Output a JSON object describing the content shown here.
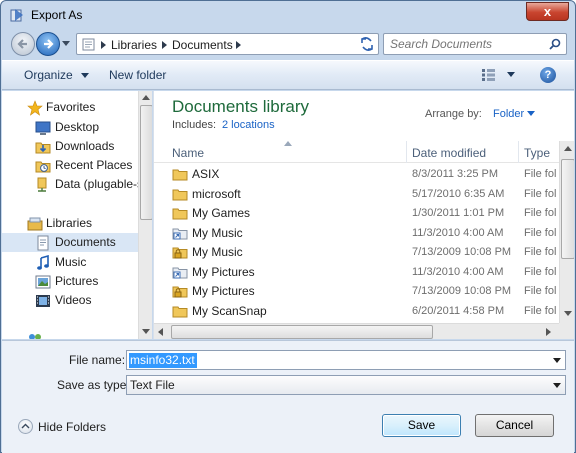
{
  "window": {
    "title": "Export As",
    "close_label": "x"
  },
  "address_bar": {
    "crumbs": [
      "Libraries",
      "Documents"
    ],
    "search_placeholder": "Search Documents"
  },
  "toolbar": {
    "organize_label": "Organize",
    "new_folder_label": "New folder",
    "help_label": "?"
  },
  "nav_pane": {
    "items": [
      {
        "label": "Favorites",
        "icon": "star-icon"
      },
      {
        "label": "Desktop",
        "icon": "desktop-icon"
      },
      {
        "label": "Downloads",
        "icon": "downloads-folder-icon"
      },
      {
        "label": "Recent Places",
        "icon": "recent-places-icon"
      },
      {
        "label": "Data (plugable-se",
        "icon": "network-drive-icon"
      },
      {
        "label": "Libraries",
        "icon": "libraries-icon"
      },
      {
        "label": "Documents",
        "icon": "documents-icon"
      },
      {
        "label": "Music",
        "icon": "music-icon"
      },
      {
        "label": "Pictures",
        "icon": "pictures-icon"
      },
      {
        "label": "Videos",
        "icon": "videos-icon"
      }
    ],
    "selected": "Documents"
  },
  "library": {
    "title": "Documents library",
    "includes_label": "Includes:",
    "locations_link": "2 locations",
    "arrange_label": "Arrange by:",
    "arrange_value": "Folder"
  },
  "columns": {
    "name": "Name",
    "date": "Date modified",
    "type": "Type"
  },
  "files": [
    {
      "name": "ASIX",
      "date": "8/3/2011 3:25 PM",
      "type": "File fol",
      "icon": "folder-icon"
    },
    {
      "name": "microsoft",
      "date": "5/17/2010 6:35 AM",
      "type": "File fol",
      "icon": "folder-icon"
    },
    {
      "name": "My Games",
      "date": "1/30/2011 1:01 PM",
      "type": "File fol",
      "icon": "folder-icon"
    },
    {
      "name": "My Music",
      "date": "11/3/2010 4:00 AM",
      "type": "File fol",
      "icon": "shortcut-folder-icon"
    },
    {
      "name": "My Music",
      "date": "7/13/2009 10:08 PM",
      "type": "File fol",
      "icon": "locked-folder-icon"
    },
    {
      "name": "My Pictures",
      "date": "11/3/2010 4:00 AM",
      "type": "File fol",
      "icon": "shortcut-folder-icon"
    },
    {
      "name": "My Pictures",
      "date": "7/13/2009 10:08 PM",
      "type": "File fol",
      "icon": "locked-folder-icon"
    },
    {
      "name": "My ScanSnap",
      "date": "6/20/2011 4:58 PM",
      "type": "File fol",
      "icon": "folder-icon"
    }
  ],
  "form": {
    "file_name_label": "File name:",
    "file_name_value": "msinfo32.txt",
    "save_type_label": "Save as type:",
    "save_type_value": "Text File",
    "hide_folders_label": "Hide Folders",
    "save_label": "Save",
    "cancel_label": "Cancel"
  },
  "colors": {
    "library_title": "#1e6a3b",
    "link": "#1a63c6",
    "selection": "#3399ff",
    "close_button": "#c9452f"
  }
}
